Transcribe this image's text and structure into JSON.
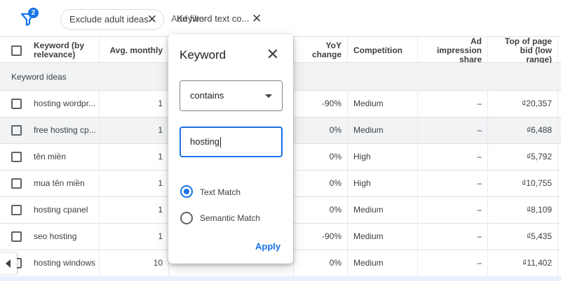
{
  "filter_bar": {
    "badge_count": "2",
    "chips": [
      {
        "label": "Exclude adult ideas"
      },
      {
        "label_back": "Add filter",
        "label_front": "Keyword text co..."
      }
    ]
  },
  "table": {
    "columns": [
      "Keyword (by relevance)",
      "Avg. monthly",
      "YoY change",
      "Competition",
      "Ad impression share",
      "Top of page bid (low range)"
    ],
    "section_label": "Keyword ideas",
    "rows": [
      {
        "keyword": "hosting wordpr...",
        "avg": "1",
        "yoy": "-90%",
        "competition": "Medium",
        "share": "–",
        "bid": "₫20,357"
      },
      {
        "keyword": "free hosting cp...",
        "avg": "1",
        "yoy": "0%",
        "competition": "Medium",
        "share": "–",
        "bid": "₫6,488"
      },
      {
        "keyword": "tên miền",
        "avg": "1",
        "yoy": "0%",
        "competition": "High",
        "share": "–",
        "bid": "₫5,792"
      },
      {
        "keyword": "mua tên miền",
        "avg": "1",
        "yoy": "0%",
        "competition": "High",
        "share": "–",
        "bid": "₫10,755"
      },
      {
        "keyword": "hosting cpanel",
        "avg": "1",
        "yoy": "0%",
        "competition": "Medium",
        "share": "–",
        "bid": "₫8,109"
      },
      {
        "keyword": "seo hosting",
        "avg": "1",
        "yoy": "-90%",
        "competition": "Medium",
        "share": "–",
        "bid": "₫5,435"
      },
      {
        "keyword": "hosting windows",
        "avg": "10",
        "yoy": "0%",
        "competition": "Medium",
        "share": "–",
        "bid": "₫11,402"
      }
    ]
  },
  "dialog": {
    "title": "Keyword",
    "operator": "contains",
    "input_value": "hosting",
    "options": [
      "Text Match",
      "Semantic Match"
    ],
    "selected_option": "Text Match",
    "apply_label": "Apply"
  },
  "colors": {
    "accent": "#1a73e8",
    "highlight_row": "#f1f3f4",
    "border": "#e0e0e0"
  },
  "icons": {
    "filter": "filter-icon",
    "close": "close-icon",
    "dropdown": "caret-down-icon",
    "scroll_left": "chevron-left-icon"
  }
}
